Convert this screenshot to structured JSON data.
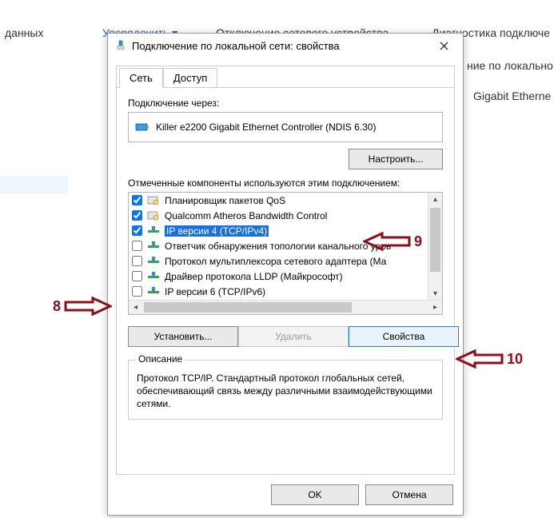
{
  "background": {
    "text1": "данных",
    "toolbar_item1": "Упорядочить ▾",
    "toolbar_item2": "Отключение сетевого устройства",
    "toolbar_item3": "Диагностика подключе",
    "line_right1": "ние по локально",
    "line_right2": "Gigabit Etherne"
  },
  "dialog": {
    "title": "Подключение по локальной сети: свойства",
    "tabs": {
      "network": "Сеть",
      "access": "Доступ"
    },
    "connect_via_label": "Подключение через:",
    "adapter_name": "Killer e2200 Gigabit Ethernet Controller (NDIS 6.30)",
    "configure_btn": "Настроить...",
    "components_label": "Отмеченные компоненты используются этим подключением:",
    "components": [
      {
        "checked": true,
        "icon": "service",
        "label": "Планировщик пакетов QoS"
      },
      {
        "checked": true,
        "icon": "service",
        "label": "Qualcomm Atheros Bandwidth Control"
      },
      {
        "checked": true,
        "icon": "protocol",
        "label": "IP версии 4 (TCP/IPv4)",
        "selected": true
      },
      {
        "checked": false,
        "icon": "protocol",
        "label": "Ответчик обнаружения топологии канального уров"
      },
      {
        "checked": false,
        "icon": "protocol",
        "label": "Протокол мультиплексора сетевого адаптера (Ма"
      },
      {
        "checked": false,
        "icon": "protocol",
        "label": "Драйвер протокола LLDP (Майкрософт)"
      },
      {
        "checked": false,
        "icon": "protocol",
        "label": "IP версии 6 (TCP/IPv6)"
      }
    ],
    "install_btn": "Установить...",
    "remove_btn": "Удалить",
    "properties_btn": "Свойства",
    "groupbox_title": "Описание",
    "description": "Протокол TCP/IP. Стандартный протокол глобальных сетей, обеспечивающий связь между различными взаимодействующими сетями.",
    "ok_btn": "OK",
    "cancel_btn": "Отмена"
  },
  "annotations": {
    "a8": "8",
    "a9": "9",
    "a10": "10"
  }
}
